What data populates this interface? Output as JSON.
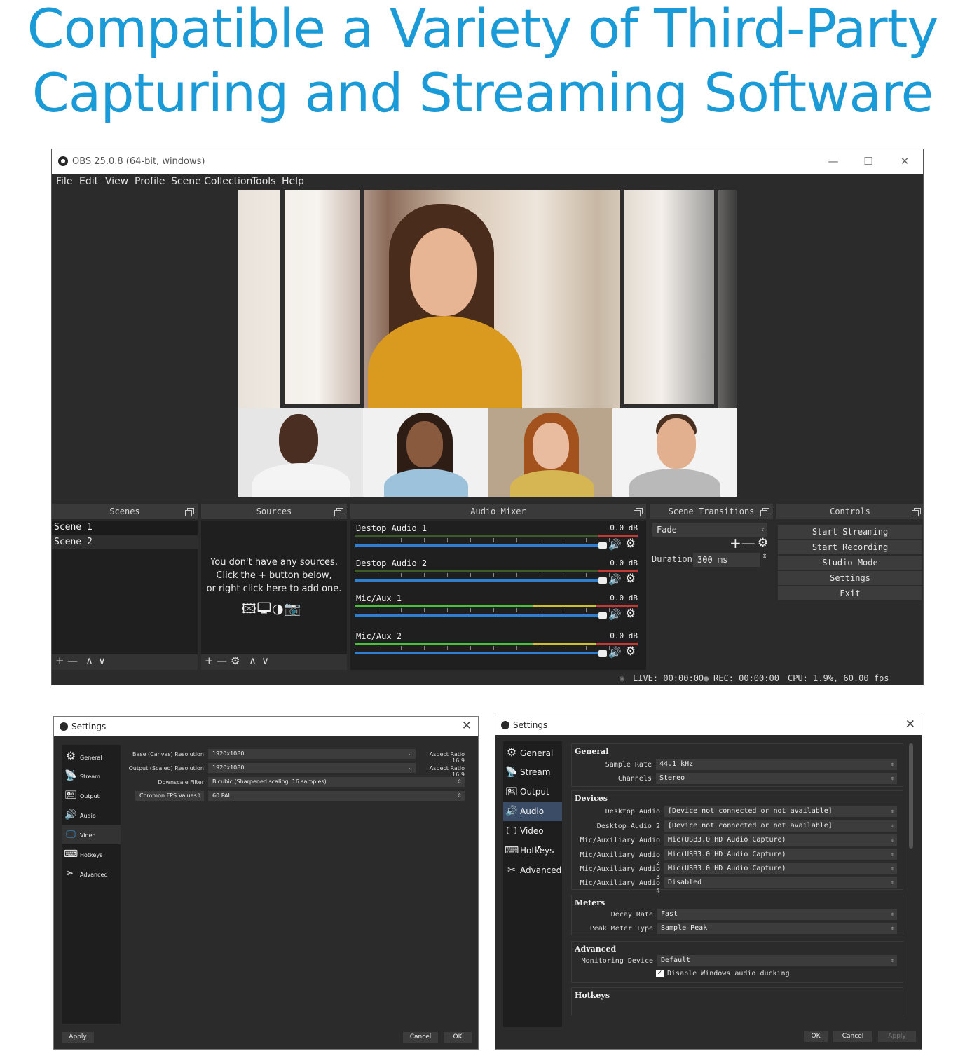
{
  "headline": {
    "line1": "Compatible a Variety of Third-Party",
    "line2": "Capturing and Streaming Software",
    "color": "#1a9bd7"
  },
  "obs": {
    "window_title": "OBS 25.0.8 (64-bit, windows)",
    "window_controls": [
      "—",
      "☐",
      "✕"
    ],
    "menu": [
      "File",
      "Edit",
      "View",
      "Profile",
      "Scene Collection",
      "Tools",
      "Help"
    ],
    "scenes": {
      "title": "Scenes",
      "items": [
        "Scene 1",
        "Scene 2"
      ],
      "footer": [
        "+",
        "—",
        "∧",
        "∨"
      ]
    },
    "sources": {
      "title": "Sources",
      "empty_line1": "You don't have any sources.",
      "empty_line2": "Click the + button below,",
      "empty_line3": "or right click here to add one.",
      "icons": "🖾🖵◑📷",
      "footer": [
        "+",
        "—",
        "⚙",
        "∧",
        "∨"
      ]
    },
    "mixer": {
      "title": "Audio Mixer",
      "channels": [
        {
          "name": "Destop Audio 1",
          "db": "0.0 dB",
          "level": 0
        },
        {
          "name": "Destop Audio 2",
          "db": "0.0 dB",
          "level": 0
        },
        {
          "name": "Mic/Aux 1",
          "db": "0.0 dB",
          "level": 1.0
        },
        {
          "name": "Mic/Aux 2",
          "db": "0.0 dB",
          "level": 1.0
        }
      ]
    },
    "transitions": {
      "title": "Scene Transitions",
      "selected": "Fade",
      "duration_label": "Duration",
      "duration_value": "300 ms",
      "add_remove": "+—",
      "cog": "⚙"
    },
    "controls": {
      "title": "Controls",
      "buttons": [
        "Start Streaming",
        "Start Recording",
        "Studio Mode",
        "Settings",
        "Exit"
      ]
    },
    "status": {
      "live": "LIVE: 00:00:00",
      "rec": "REC: 00:00:00",
      "cpu": "CPU: 1.9%, 60.00 fps"
    }
  },
  "settings_video": {
    "title": "Settings",
    "close": "✕",
    "sidebar": [
      "General",
      "Stream",
      "Output",
      "Audio",
      "Video",
      "Hotkeys",
      "Advanced"
    ],
    "sidebar_icons": [
      "⚙",
      "📡",
      "🖭",
      "🔊",
      "🖵",
      "⌨",
      "✂"
    ],
    "selected": "Video",
    "rows": [
      {
        "label": "Base (Canvas) Resolution",
        "value": "1920x1080",
        "aspect": "Aspect Ratio 16:9"
      },
      {
        "label": "Output (Scaled) Resolution",
        "value": "1920x1080",
        "aspect": "Aspect Ratio 16:9"
      },
      {
        "label": "Downscale Filter",
        "value": "Bicubic (Sharpened scaling, 16 samples)"
      },
      {
        "label": "Common FPS Values",
        "value": "60 PAL"
      }
    ],
    "buttons": {
      "apply": "Apply",
      "cancel": "Cancel",
      "ok": "OK"
    }
  },
  "settings_audio": {
    "title": "Settings",
    "close": "✕",
    "sidebar": [
      "General",
      "Stream",
      "Output",
      "Audio",
      "Video",
      "Hotkeys",
      "Advanced"
    ],
    "sidebar_icons": [
      "⚙",
      "📡",
      "🖭",
      "🔊",
      "🖵",
      "⌨",
      "✂"
    ],
    "selected": "Audio",
    "general": {
      "title": "General",
      "rows": [
        {
          "label": "Sample Rate",
          "value": "44.1 kHz"
        },
        {
          "label": "Channels",
          "value": "Stereo"
        }
      ]
    },
    "devices": {
      "title": "Devices",
      "rows": [
        {
          "label": "Desktop Audio",
          "value": "[Device not connected or not available]"
        },
        {
          "label": "Desktop Audio 2",
          "value": "[Device not connected or not available]"
        },
        {
          "label": "Mic/Auxiliary Audio",
          "value": "Mic(USB3.0 HD Audio Capture)"
        },
        {
          "label": "Mic/Auxiliary Audio 2",
          "value": "Mic(USB3.0 HD Audio Capture)"
        },
        {
          "label": "Mic/Auxiliary Audio 3",
          "value": "Mic(USB3.0 HD Audio Capture)"
        },
        {
          "label": "Mic/Auxiliary Audio 4",
          "value": "Disabled"
        }
      ]
    },
    "meters": {
      "title": "Meters",
      "rows": [
        {
          "label": "Decay Rate",
          "value": "Fast"
        },
        {
          "label": "Peak Meter Type",
          "value": "Sample Peak"
        }
      ]
    },
    "advanced": {
      "title": "Advanced",
      "rows": [
        {
          "label": "Monitoring Device",
          "value": "Default"
        }
      ],
      "checkbox": "Disable Windows audio ducking",
      "checked": true
    },
    "hotkeys_title": "Hotkeys",
    "buttons": {
      "ok": "OK",
      "cancel": "Cancel",
      "apply": "Apply"
    }
  }
}
